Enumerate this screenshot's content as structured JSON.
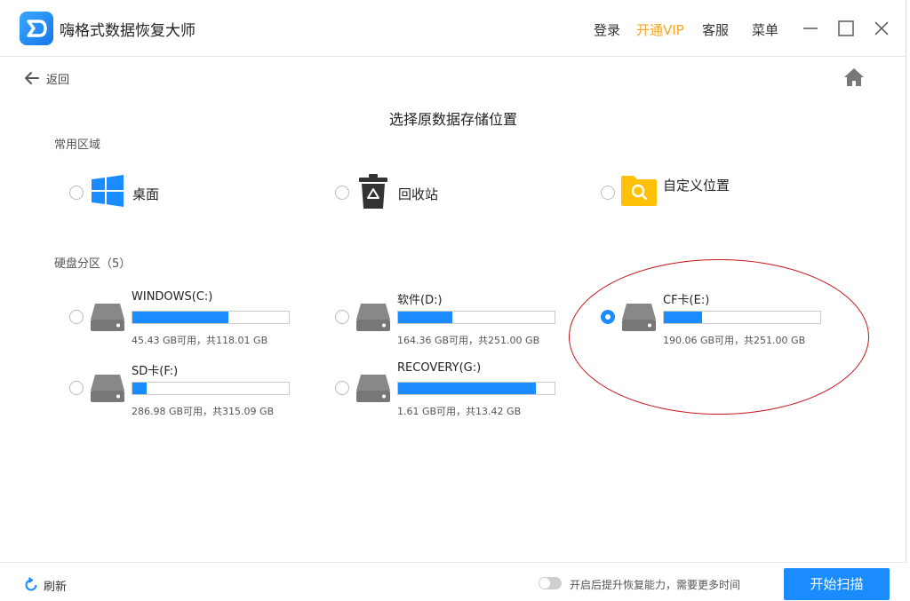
{
  "app": {
    "title": "嗨格式数据恢复大师",
    "login": "登录",
    "vip": "开通VIP",
    "service": "客服",
    "menu": "菜单"
  },
  "nav": {
    "back": "返回"
  },
  "page": {
    "title": "选择原数据存储位置"
  },
  "common": {
    "label": "常用区域",
    "items": [
      {
        "label": "桌面",
        "icon": "windows-icon",
        "selected": false
      },
      {
        "label": "回收站",
        "icon": "recycle-bin-icon",
        "selected": false
      },
      {
        "label": "自定义位置",
        "icon": "folder-search-icon",
        "selected": false
      }
    ]
  },
  "disks": {
    "label": "硬盘分区（5）",
    "items": [
      {
        "name": "WINDOWS(C:)",
        "info": "45.43 GB可用，共118.01 GB",
        "used_fraction": 0.615,
        "selected": false
      },
      {
        "name": "软件(D:)",
        "info": "164.36 GB可用，共251.00 GB",
        "used_fraction": 0.345,
        "selected": false
      },
      {
        "name": "CF卡(E:)",
        "info": "190.06 GB可用，共251.00 GB",
        "used_fraction": 0.243,
        "selected": true
      },
      {
        "name": "SD卡(F:)",
        "info": "286.98 GB可用，共315.09 GB",
        "used_fraction": 0.089,
        "selected": false
      },
      {
        "name": "RECOVERY(G:)",
        "info": "1.61 GB可用，共13.42 GB",
        "used_fraction": 0.88,
        "selected": false
      }
    ]
  },
  "footer": {
    "refresh": "刷新",
    "toggle_label": "开启后提升恢复能力，需要更多时间",
    "toggle_on": false,
    "start": "开始扫描"
  },
  "colors": {
    "accent": "#1a8cff",
    "vip": "#f5a623",
    "annotation": "#c4151c"
  }
}
